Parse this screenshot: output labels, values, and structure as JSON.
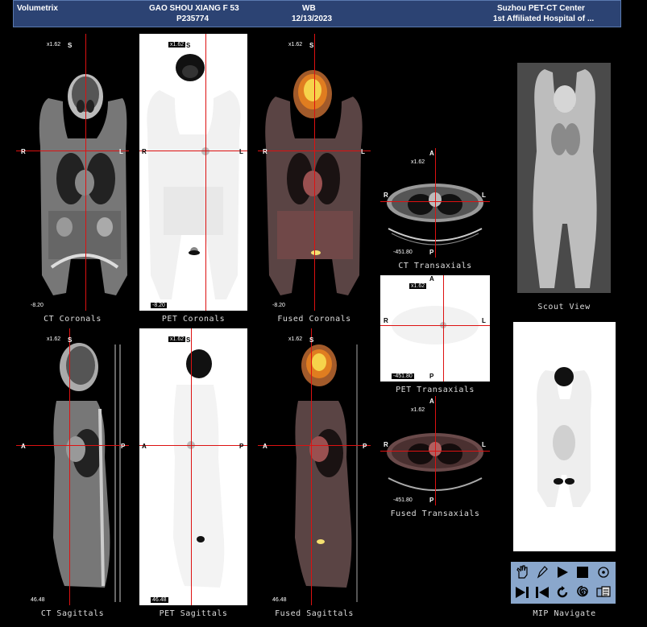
{
  "header": {
    "app_name": "Volumetrix",
    "patient_name": "GAO SHOU XIANG F 53",
    "patient_id": "P235774",
    "study_type": "WB",
    "study_date": "12/13/2023",
    "center": "Suzhou PET-CT Center",
    "hospital": "1st Affiliated Hospital of ..."
  },
  "views": {
    "ct_coronals": {
      "caption": "CT Coronals",
      "zoom": "x1.62",
      "top": "S",
      "left": "R",
      "right": "L",
      "slice": "-8.20"
    },
    "pet_coronals": {
      "caption": "PET Coronals",
      "zoom": "x1.62",
      "top": "S",
      "left": "R",
      "right": "L",
      "slice": "-8.20"
    },
    "fused_coronals": {
      "caption": "Fused Coronals",
      "zoom": "x1.62",
      "top": "S",
      "left": "R",
      "right": "L",
      "slice": "-8.20"
    },
    "ct_sagittals": {
      "caption": "CT Sagittals",
      "zoom": "x1.62",
      "top": "S",
      "left": "A",
      "right": "P",
      "slice": "46.48"
    },
    "pet_sagittals": {
      "caption": "PET Sagittals",
      "zoom": "x1.62",
      "top": "S",
      "left": "A",
      "right": "P",
      "slice": "46.48"
    },
    "fused_sagittals": {
      "caption": "Fused Sagittals",
      "zoom": "x1.62",
      "top": "S",
      "left": "A",
      "right": "P",
      "slice": "46.48"
    },
    "ct_transaxials": {
      "caption": "CT Transaxials",
      "zoom": "x1.62",
      "top": "A",
      "bottom": "P",
      "left": "R",
      "right": "L",
      "slice": "-451.80"
    },
    "pet_transaxials": {
      "caption": "PET Transaxials",
      "zoom": "x1.62",
      "top": "A",
      "bottom": "P",
      "left": "R",
      "right": "L",
      "slice": "-451.80"
    },
    "fused_transaxials": {
      "caption": "Fused Transaxials",
      "zoom": "x1.62",
      "top": "A",
      "bottom": "P",
      "left": "R",
      "right": "L",
      "slice": "-451.80"
    },
    "scout": {
      "caption": "Scout View"
    },
    "mip": {
      "caption": "MIP Navigate"
    }
  },
  "toolbar": {
    "tools": [
      "hand-cursor-icon",
      "pencil-icon",
      "play-icon",
      "stop-icon",
      "target-icon",
      "step-forward-icon",
      "step-back-icon",
      "rotate-icon",
      "spiral-icon",
      "export-icon"
    ]
  },
  "colors": {
    "header_bg": "#2c4373",
    "crosshair": "#dd1111",
    "toolbar_bg": "#8aa7cc"
  }
}
